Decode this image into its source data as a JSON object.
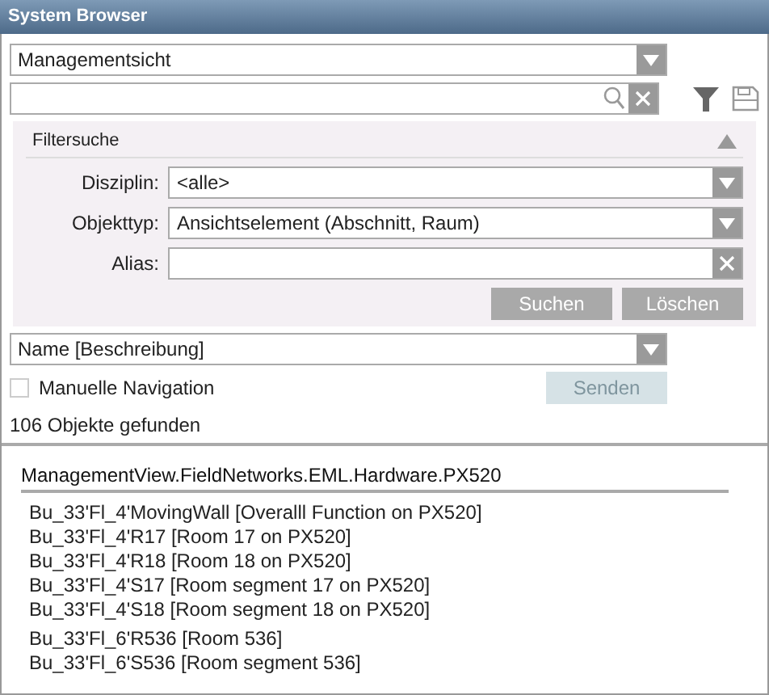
{
  "window": {
    "title": "System Browser"
  },
  "view_select": {
    "value": "Managementsicht"
  },
  "filter": {
    "title": "Filtersuche",
    "expanded": true,
    "fields": [
      {
        "kind": "select",
        "label": "Disziplin:",
        "value": "<alle>"
      },
      {
        "kind": "select",
        "label": "Objekttyp:",
        "value": "Ansichtselement (Abschnitt, Raum)"
      },
      {
        "kind": "text",
        "label": "Alias:"
      }
    ],
    "buttons": [
      {
        "label": "Suchen"
      },
      {
        "label": "Löschen"
      }
    ]
  },
  "display_select": {
    "value": "Name [Beschreibung]"
  },
  "manual_navigation": {
    "label": "Manuelle Navigation",
    "checked": false
  },
  "send_button": {
    "label": "Senden",
    "disabled": true
  },
  "result_count": "106 Objekte gefunden",
  "results": {
    "path": "ManagementView.FieldNetworks.EML.Hardware.PX520",
    "groups": [
      [
        "Bu_33'Fl_4'MovingWall [Overalll Function on PX520]",
        "Bu_33'Fl_4'R17 [Room 17 on PX520]",
        "Bu_33'Fl_4'R18 [Room 18 on PX520]",
        "Bu_33'Fl_4'S17 [Room segment 17 on PX520]",
        "Bu_33'Fl_4'S18 [Room segment 18 on PX520]"
      ],
      [
        "Bu_33'Fl_6'R536 [Room 536]",
        "Bu_33'Fl_6'S536 [Room segment 536]"
      ]
    ]
  }
}
